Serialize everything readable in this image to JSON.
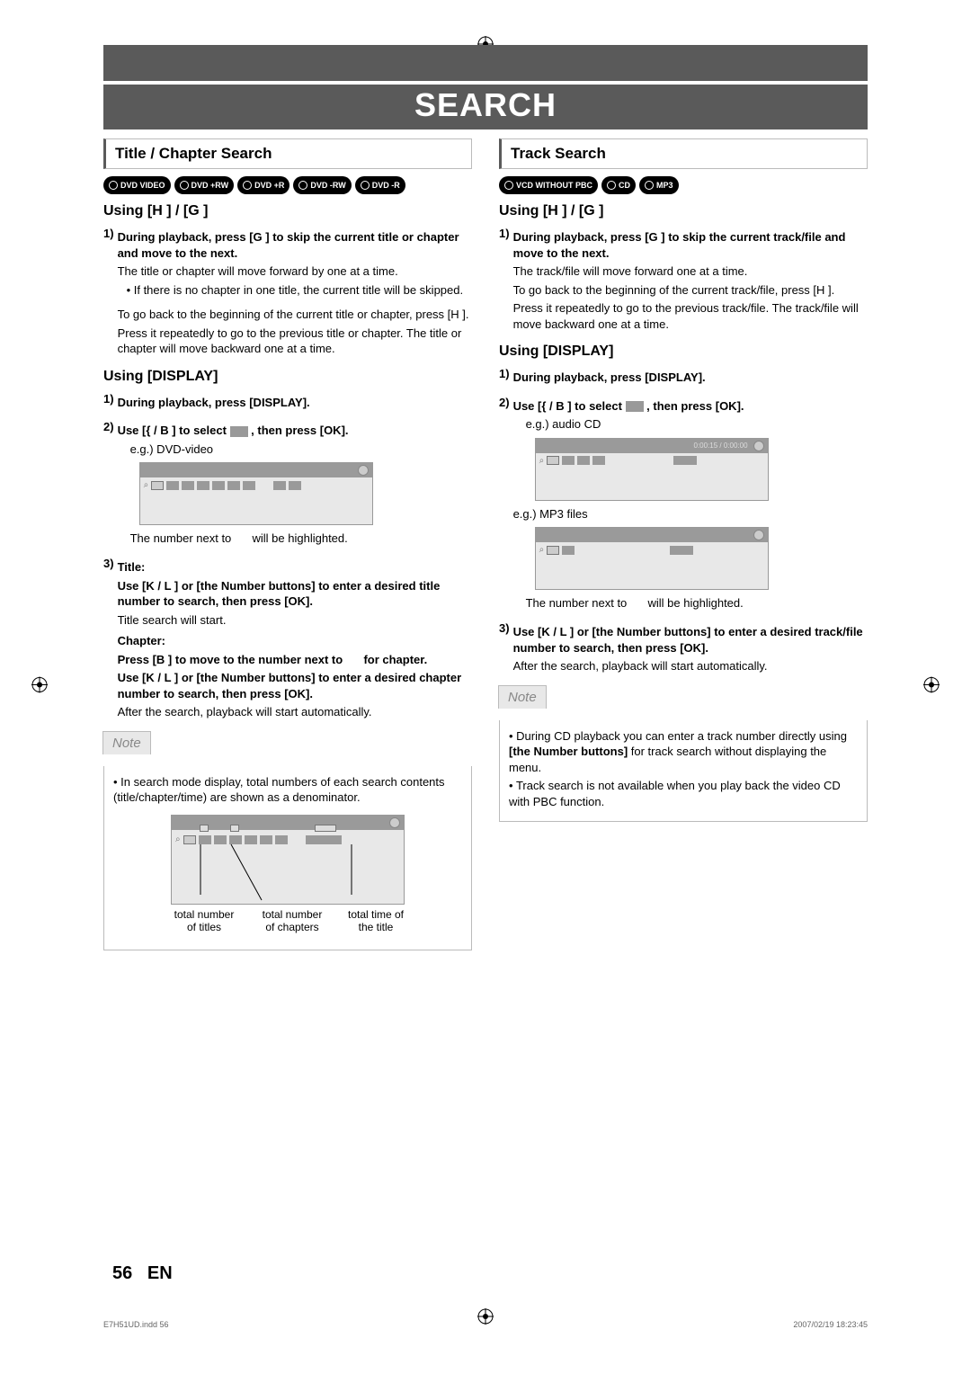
{
  "header": {
    "main_title": "SEARCH"
  },
  "left": {
    "section_heading": "Title / Chapter Search",
    "badges": [
      "DVD VIDEO",
      "DVD +RW",
      "DVD +R",
      "DVD -RW",
      "DVD -R"
    ],
    "using_skip_heading": "Using [H   ] / [G   ]",
    "step1": {
      "num": "1)",
      "bold": "During playback, press [G   ] to skip the current title or chapter and move to the next.",
      "p1": "The title or chapter will move forward by one at a time.",
      "bullet": "If there is no chapter in one title, the current title will be skipped.",
      "p2": "To go back to the beginning of the current title or chapter, press [H   ].",
      "p3": "Press it repeatedly to go to the previous title or chapter. The title or chapter will move backward one at a time."
    },
    "using_display_heading": "Using [DISPLAY]",
    "d_step1": {
      "num": "1)",
      "bold": "During playback, press [DISPLAY]."
    },
    "d_step2": {
      "num": "2)",
      "bold_a": "Use [{   / B ] to select ",
      "bold_b": " , then press [OK].",
      "eg": "e.g.) DVD-video",
      "caption_a": "The number next to ",
      "caption_b": " will be highlighted."
    },
    "d_step3": {
      "num": "3)",
      "title_label": "Title:",
      "title_bold": "Use [K / L ] or [the Number buttons] to enter a desired title number to search, then press [OK].",
      "title_after": "Title search will start.",
      "chapter_label": "Chapter:",
      "ch_bold_a": "Press [B ] to move to the number next to ",
      "ch_bold_b": " for chapter.",
      "ch_bold2": "Use [K / L ] or [the Number buttons] to enter a desired chapter number to search, then press [OK].",
      "ch_after": "After the search, playback will start automatically."
    },
    "note": {
      "title": "Note",
      "item": "In search mode display, total numbers of each search contents (title/chapter/time) are shown as a denominator.",
      "lbl1": "total number of titles",
      "lbl2": "total number of chapters",
      "lbl3": "total time of the title"
    }
  },
  "right": {
    "section_heading": "Track Search",
    "badges": [
      "VCD WITHOUT PBC",
      "CD",
      "MP3"
    ],
    "using_skip_heading": "Using [H   ] / [G   ]",
    "step1": {
      "num": "1)",
      "bold": "During playback, press [G   ] to skip the current track/file and move to the next.",
      "p1": "The track/file will move forward one at a time.",
      "p2": "To go back to the beginning of the current track/file, press [H   ].",
      "p3": "Press it repeatedly to go to the previous track/file. The track/file will move backward one at a time."
    },
    "using_display_heading": "Using [DISPLAY]",
    "d_step1": {
      "num": "1)",
      "bold": "During playback, press [DISPLAY]."
    },
    "d_step2": {
      "num": "2)",
      "bold_a": "Use [{   / B ] to select ",
      "bold_b": " , then press [OK].",
      "eg1": "e.g.) audio CD",
      "time1": "0:00:15 / 0:00:00",
      "eg2": "e.g.) MP3 files",
      "caption_a": "The number next to ",
      "caption_b": " will be highlighted."
    },
    "d_step3": {
      "num": "3)",
      "bold": "Use [K / L ] or [the Number buttons] to enter a desired track/file number to search, then press [OK].",
      "after": "After the search, playback will start automatically."
    },
    "note": {
      "title": "Note",
      "item1_a": "During CD playback you can enter a track number directly using ",
      "item1_b": "[the Number buttons]",
      "item1_c": " for track search without displaying the menu.",
      "item2": "Track search is not available when you play back the video CD with PBC function."
    }
  },
  "footer": {
    "page_num": "56",
    "lang": "EN"
  },
  "print_meta": {
    "left": "E7H51UD.indd   56",
    "right": "2007/02/19   18:23:45"
  }
}
